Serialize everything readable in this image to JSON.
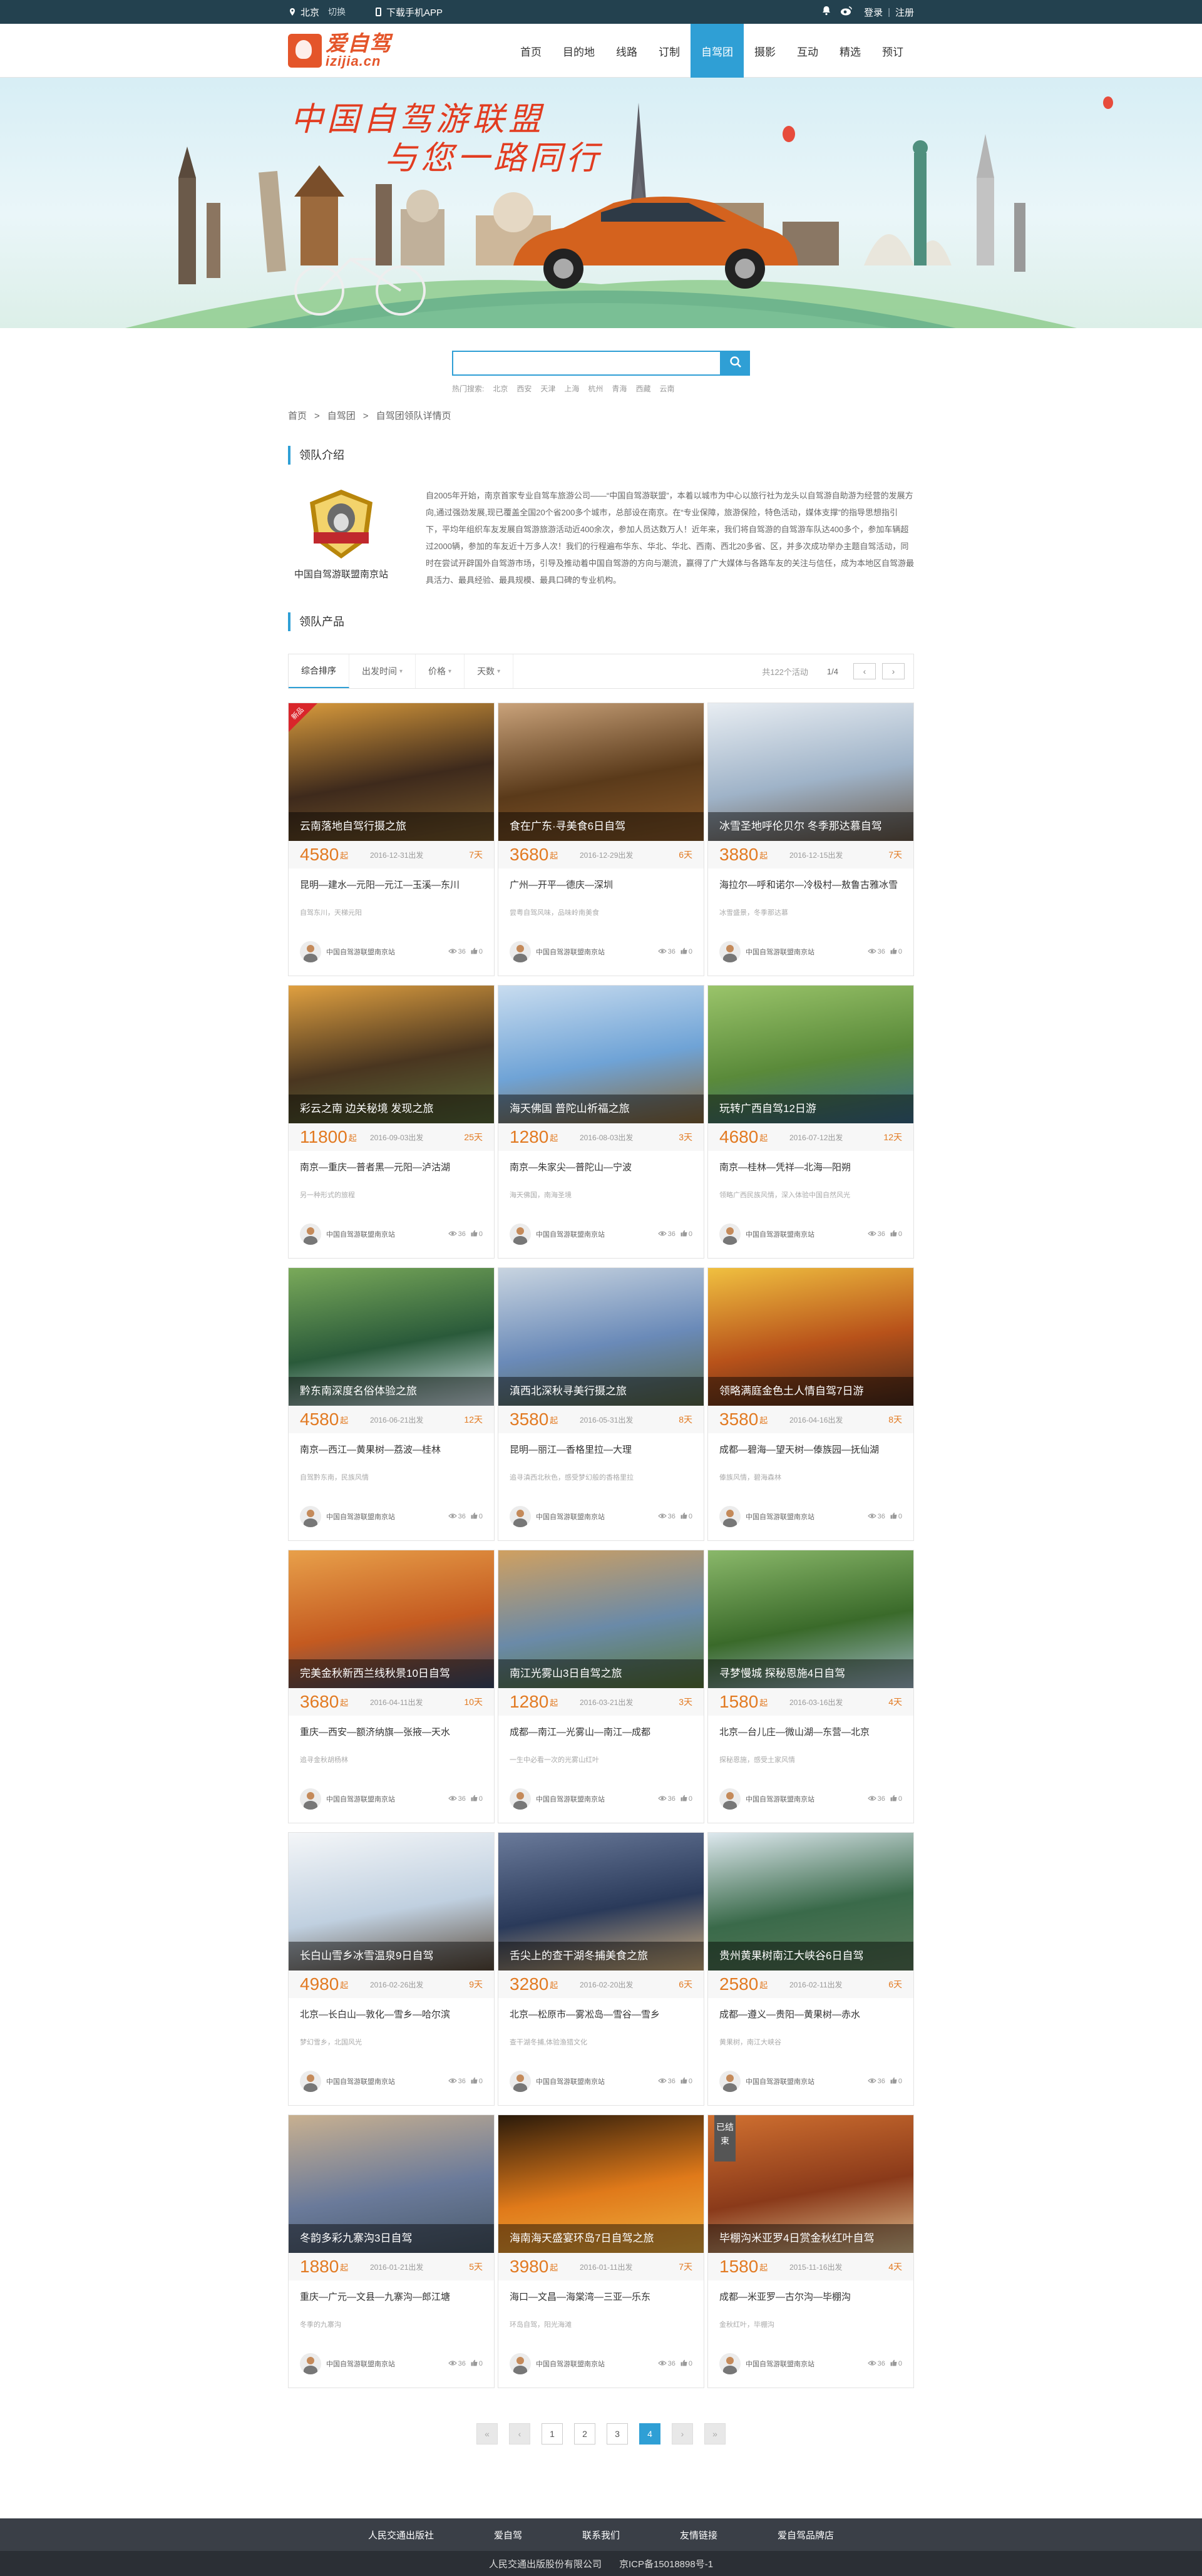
{
  "topbar": {
    "city": "北京",
    "switch": "切换",
    "app": "下载手机APP",
    "login": "登录",
    "sep": "|",
    "register": "注册"
  },
  "logo": {
    "cn": "爱自驾",
    "en": "izijia.cn"
  },
  "nav": [
    "首页",
    "目的地",
    "线路",
    "订制",
    "自驾团",
    "摄影",
    "互动",
    "精选",
    "预订"
  ],
  "banner": {
    "line1": "中国自驾游联盟",
    "line2": "与您一路同行"
  },
  "search": {
    "placeholder": "",
    "hot_label": "热门搜索:",
    "hot": [
      "北京",
      "西安",
      "天津",
      "上海",
      "杭州",
      "青海",
      "西藏",
      "云南"
    ]
  },
  "breadcrumb": [
    "首页",
    "自驾团",
    "自驾团领队详情页"
  ],
  "sections": {
    "intro": "领队介绍",
    "products": "领队产品"
  },
  "team": {
    "name": "中国自驾游联盟南京站",
    "desc": "自2005年开始，南京首家专业自驾车旅游公司——“中国自驾游联盟”，本着以城市为中心以旅行社为龙头以自驾游自助游为经营的发展方向,通过强劲发展,现已覆盖全国20个省200多个城市，总部设在南京。在“专业保障，旅游保险，特色活动，媒体支撑”的指导思想指引下，平均年组织车友发展自驾游旅游活动近400余次，参加人员达数万人！近年来，我们将自驾游的自驾游车队达400多个，参加车辆超过2000辆，参加的车友近十万多人次！我们的行程遍布华东、华北、华北、西南、西北20多省、区，并多次成功举办主题自驾活动，同时在尝试开辟国外自驾游市场，引导及推动着中国自驾游的方向与潮流，赢得了广大媒体与各路车友的关注与信任，成为本地区自驾游最具活力、最具经验、最具规模、最具口碑的专业机构。"
  },
  "filter": {
    "tabs": [
      "综合排序",
      "出发时间",
      "价格",
      "天数"
    ],
    "count": "共122个活动",
    "page": "1/4",
    "prev": "‹",
    "next": "›"
  },
  "products": [
    {
      "caption": "云南落地自驾行摄之旅",
      "price": "4580",
      "qi": "起",
      "date": "2016-12-31出发",
      "days": "7天",
      "route": "昆明—建水—元阳—元江—玉溪—东川",
      "sub": "自驾东川，天梯元阳",
      "team": "中国自驾游联盟南京站",
      "views": "36",
      "likes": "0",
      "badge": "新品"
    },
    {
      "caption": "食在广东·寻美食6日自驾",
      "price": "3680",
      "qi": "起",
      "date": "2016-12-29出发",
      "days": "6天",
      "route": "广州—开平—德庆—深圳",
      "sub": "尝粤自驾风味，品味岭南美食",
      "team": "中国自驾游联盟南京站",
      "views": "36",
      "likes": "0"
    },
    {
      "caption": "冰雪圣地呼伦贝尔 冬季那达慕自驾",
      "price": "3880",
      "qi": "起",
      "date": "2016-12-15出发",
      "days": "7天",
      "route": "海拉尔—呼和诺尔—冷极村—敖鲁古雅冰雪",
      "sub": "冰雪盛景，冬季那达慕",
      "team": "中国自驾游联盟南京站",
      "views": "36",
      "likes": "0"
    },
    {
      "caption": "彩云之南 边关秘境 发现之旅",
      "price": "11800",
      "qi": "起",
      "date": "2016-09-03出发",
      "days": "25天",
      "route": "南京—重庆—普者黑—元阳—泸沽湖",
      "sub": "另一种形式的旅程",
      "team": "中国自驾游联盟南京站",
      "views": "36",
      "likes": "0"
    },
    {
      "caption": "海天佛国 普陀山祈福之旅",
      "price": "1280",
      "qi": "起",
      "date": "2016-08-03出发",
      "days": "3天",
      "route": "南京—朱家尖—普陀山—宁波",
      "sub": "海天佛国，南海圣境",
      "team": "中国自驾游联盟南京站",
      "views": "36",
      "likes": "0"
    },
    {
      "caption": "玩转广西自驾12日游",
      "price": "4680",
      "qi": "起",
      "date": "2016-07-12出发",
      "days": "12天",
      "route": "南京—桂林—凭祥—北海—阳朔",
      "sub": "领略广西民族风情，深入体验中国自然风光",
      "team": "中国自驾游联盟南京站",
      "views": "36",
      "likes": "0"
    },
    {
      "caption": "黔东南深度名俗体验之旅",
      "price": "4580",
      "qi": "起",
      "date": "2016-06-21出发",
      "days": "12天",
      "route": "南京—西江—黄果树—荔波—桂林",
      "sub": "自驾黔东南，民族风情",
      "team": "中国自驾游联盟南京站",
      "views": "36",
      "likes": "0"
    },
    {
      "caption": "滇西北深秋寻美行摄之旅",
      "price": "3580",
      "qi": "起",
      "date": "2016-05-31出发",
      "days": "8天",
      "route": "昆明—丽江—香格里拉—大理",
      "sub": "追寻滇西北秋色，感受梦幻般的香格里拉",
      "team": "中国自驾游联盟南京站",
      "views": "36",
      "likes": "0"
    },
    {
      "caption": "领略满庭金色土人情自驾7日游",
      "price": "3580",
      "qi": "起",
      "date": "2016-04-16出发",
      "days": "8天",
      "route": "成都—碧海—望天树—傣族园—抚仙湖",
      "sub": "傣族风情，碧海森林",
      "team": "中国自驾游联盟南京站",
      "views": "36",
      "likes": "0"
    },
    {
      "caption": "完美金秋新西兰线秋景10日自驾",
      "price": "3680",
      "qi": "起",
      "date": "2016-04-11出发",
      "days": "10天",
      "route": "重庆—西安—额济纳旗—张掖—天水",
      "sub": "追寻金秋胡杨林",
      "team": "中国自驾游联盟南京站",
      "views": "36",
      "likes": "0"
    },
    {
      "caption": "南江光雾山3日自驾之旅",
      "price": "1280",
      "qi": "起",
      "date": "2016-03-21出发",
      "days": "3天",
      "route": "成都—南江—光雾山—南江—成都",
      "sub": "一生中必看一次的光雾山红叶",
      "team": "中国自驾游联盟南京站",
      "views": "36",
      "likes": "0"
    },
    {
      "caption": "寻梦慢城 探秘恩施4日自驾",
      "price": "1580",
      "qi": "起",
      "date": "2016-03-16出发",
      "days": "4天",
      "route": "北京—台儿庄—微山湖—东营—北京",
      "sub": "探秘恩施，感受土家风情",
      "team": "中国自驾游联盟南京站",
      "views": "36",
      "likes": "0"
    },
    {
      "caption": "长白山雪乡冰雪温泉9日自驾",
      "price": "4980",
      "qi": "起",
      "date": "2016-02-26出发",
      "days": "9天",
      "route": "北京—长白山—敦化—雪乡—哈尔滨",
      "sub": "梦幻雪乡，北国风光",
      "team": "中国自驾游联盟南京站",
      "views": "36",
      "likes": "0"
    },
    {
      "caption": "舌尖上的查干湖冬捕美食之旅",
      "price": "3280",
      "qi": "起",
      "date": "2016-02-20出发",
      "days": "6天",
      "route": "北京—松原市—雾凇岛—雪谷—雪乡",
      "sub": "查干湖冬捕,体验渔猎文化",
      "team": "中国自驾游联盟南京站",
      "views": "36",
      "likes": "0"
    },
    {
      "caption": "贵州黄果树南江大峡谷6日自驾",
      "price": "2580",
      "qi": "起",
      "date": "2016-02-11出发",
      "days": "6天",
      "route": "成都—遵义—贵阳—黄果树—赤水",
      "sub": "黄果树，南江大峡谷",
      "team": "中国自驾游联盟南京站",
      "views": "36",
      "likes": "0"
    },
    {
      "caption": "冬韵多彩九寨沟3日自驾",
      "price": "1880",
      "qi": "起",
      "date": "2016-01-21出发",
      "days": "5天",
      "route": "重庆—广元—文县—九寨沟—郎江塘",
      "sub": "冬季的九寨沟",
      "team": "中国自驾游联盟南京站",
      "views": "36",
      "likes": "0"
    },
    {
      "caption": "海南海天盛宴环岛7日自驾之旅",
      "price": "3980",
      "qi": "起",
      "date": "2016-01-11出发",
      "days": "7天",
      "route": "海口—文昌—海棠湾—三亚—乐东",
      "sub": "环岛自驾，阳光海滩",
      "team": "中国自驾游联盟南京站",
      "views": "36",
      "likes": "0"
    },
    {
      "caption": "毕棚沟米亚罗4日赏金秋红叶自驾",
      "price": "1580",
      "qi": "起",
      "date": "2015-11-16出发",
      "days": "4天",
      "route": "成都—米亚罗—古尔沟—毕棚沟",
      "sub": "金秋红叶，毕棚沟",
      "team": "中国自驾游联盟南京站",
      "views": "36",
      "likes": "0",
      "ended": "已结束"
    }
  ],
  "pagination": {
    "pages": [
      "1",
      "2",
      "3",
      "4"
    ],
    "current": "4",
    "first": "«",
    "prev": "‹",
    "next": "›",
    "last": "»"
  },
  "footer": {
    "links": [
      "人民交通出版社",
      "爱自驾",
      "联系我们",
      "友情链接",
      "爱自驾品牌店"
    ],
    "copy": [
      "人民交通出版股份有限公司",
      "京ICP备15018898号-1"
    ]
  },
  "colors": {
    "accent": "#2f9fd5",
    "price": "#e27a22",
    "topbar": "#23414f",
    "logo": "#e4552a"
  }
}
